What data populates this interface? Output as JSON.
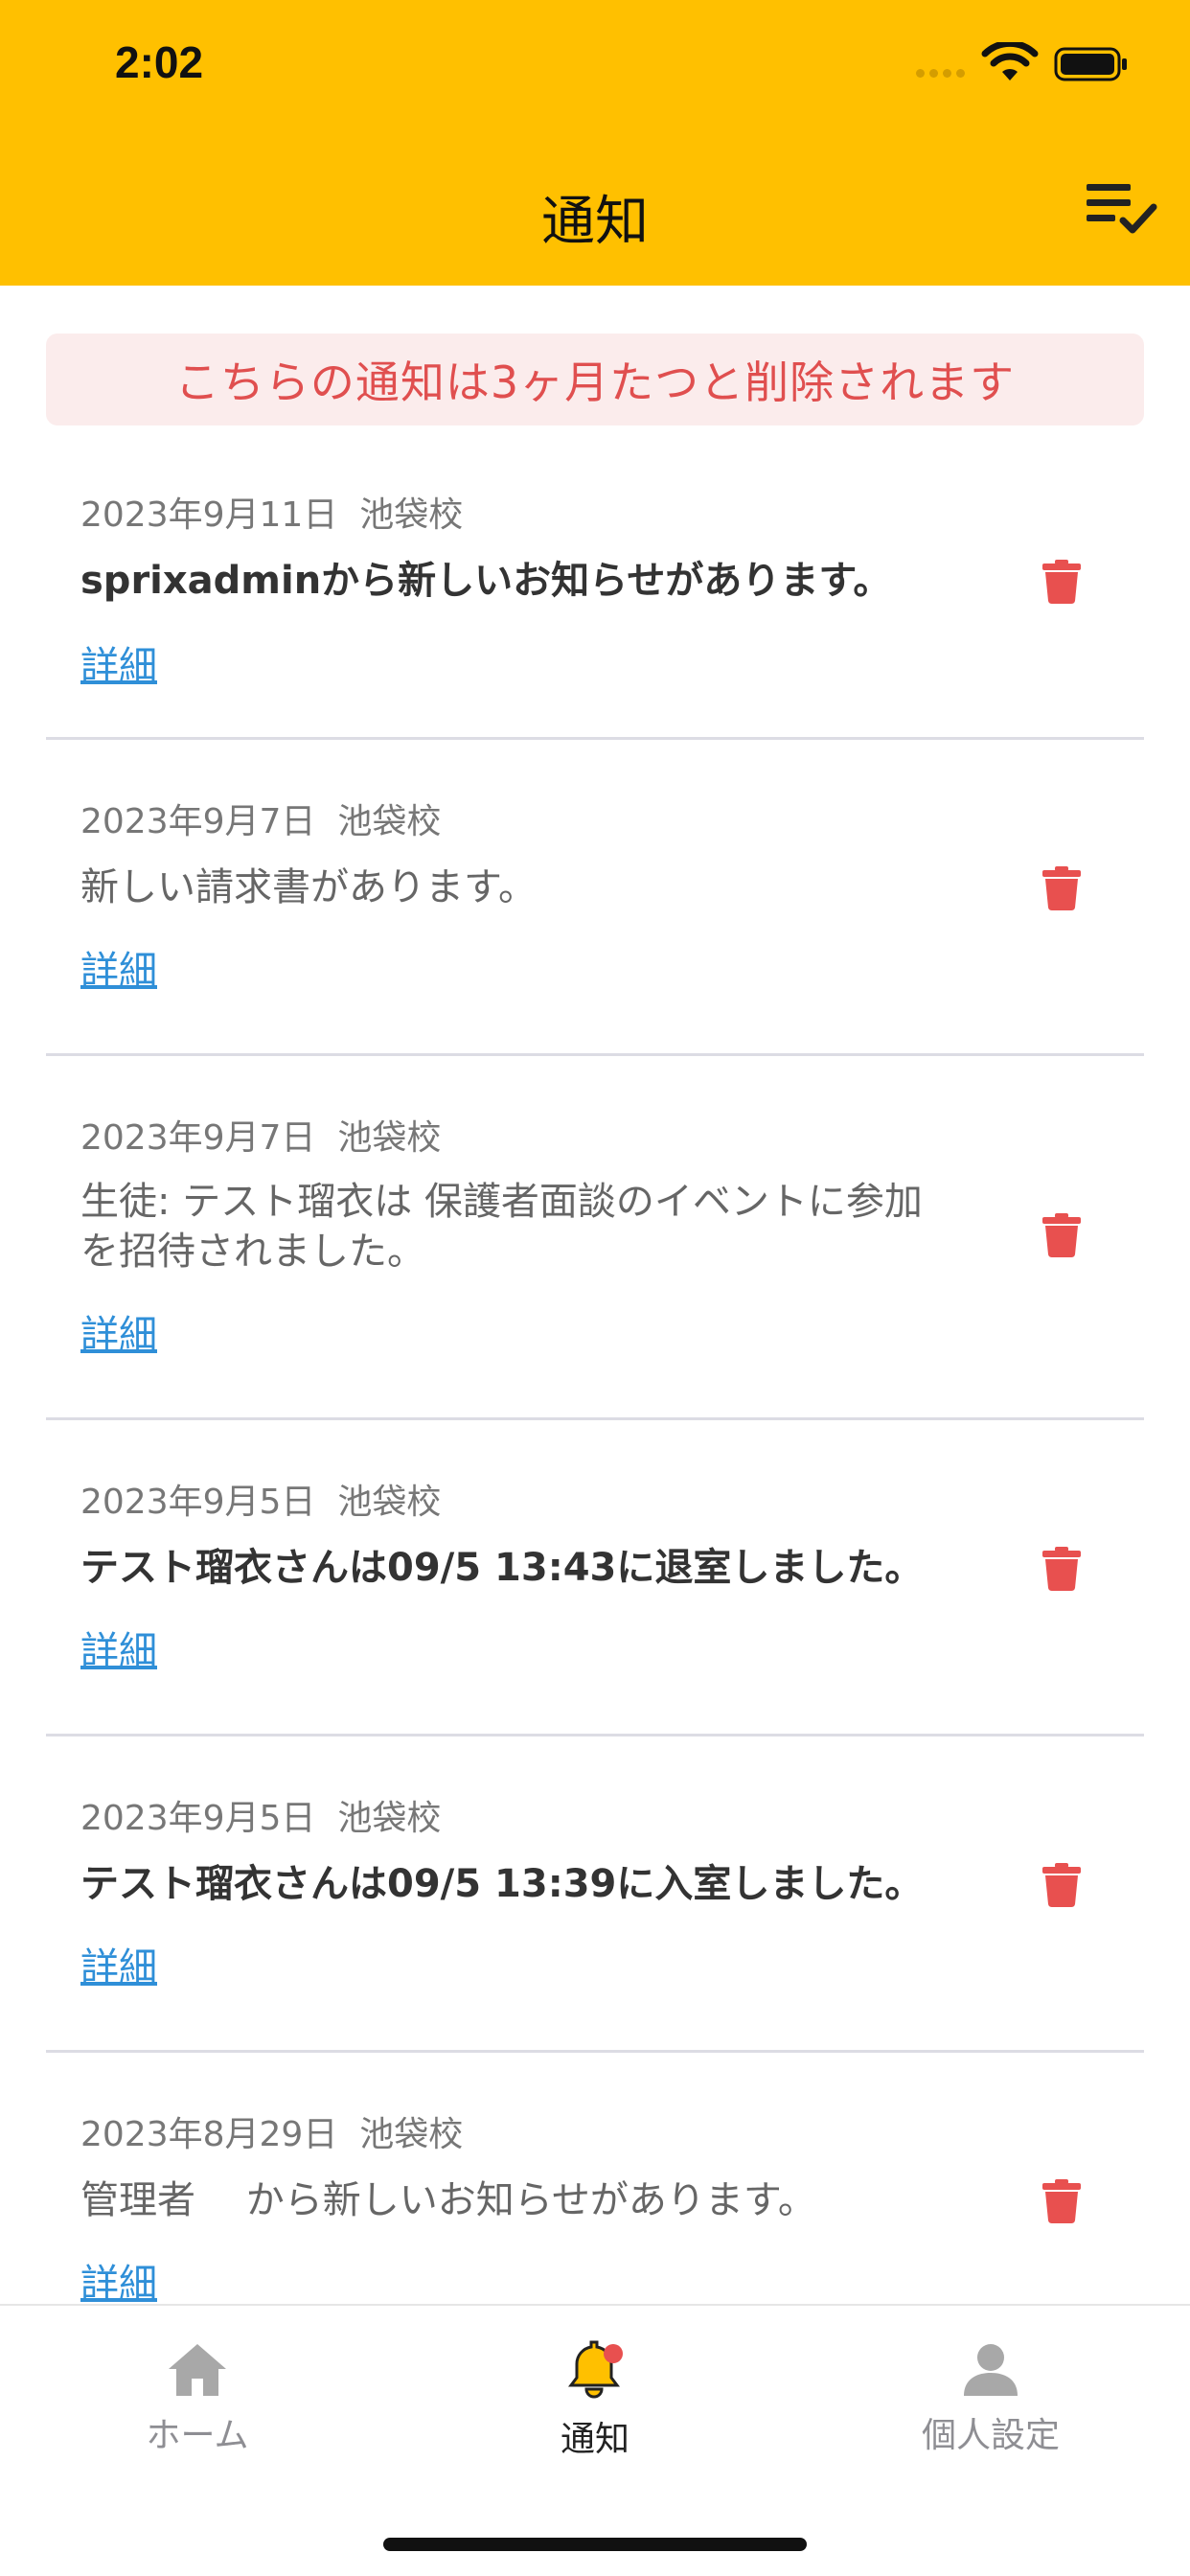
{
  "status_bar": {
    "time": "2:02"
  },
  "header": {
    "title": "通知",
    "mark_all_icon": "list-check-icon"
  },
  "banner": {
    "text": "こちらの通知は3ヶ月たつと削除されます"
  },
  "notifications": [
    {
      "date": "2023年9月11日",
      "school": "池袋校",
      "message": "sprixadminから新しいお知らせがあります。",
      "unread": true,
      "link": "詳細"
    },
    {
      "date": "2023年9月7日",
      "school": "池袋校",
      "message": "新しい請求書があります。",
      "unread": false,
      "link": "詳細"
    },
    {
      "date": "2023年9月7日",
      "school": "池袋校",
      "message_line1": "生徒: テスト瑠衣は 保護者面談のイベントに参加",
      "message_line2": "を招待されました。",
      "unread": false,
      "link": "詳細"
    },
    {
      "date": "2023年9月5日",
      "school": "池袋校",
      "message": "テスト瑠衣さんは09/5 13:43に退室しました。",
      "unread": true,
      "link": "詳細"
    },
    {
      "date": "2023年9月5日",
      "school": "池袋校",
      "message": "テスト瑠衣さんは09/5 13:39に入室しました。",
      "unread": true,
      "link": "詳細"
    },
    {
      "date": "2023年8月29日",
      "school": "池袋校",
      "message": "管理者　 から新しいお知らせがあります。",
      "unread": false,
      "link": "詳細"
    }
  ],
  "tabbar": {
    "tabs": [
      {
        "label": "ホーム",
        "icon": "home-icon",
        "active": false
      },
      {
        "label": "通知",
        "icon": "bell-icon",
        "active": true,
        "badge": true
      },
      {
        "label": "個人設定",
        "icon": "person-icon",
        "active": false
      }
    ]
  },
  "colors": {
    "accent": "#FFC000",
    "danger": "#E8504F",
    "link": "#2F8FD8",
    "banner_bg": "#FBECEC"
  }
}
